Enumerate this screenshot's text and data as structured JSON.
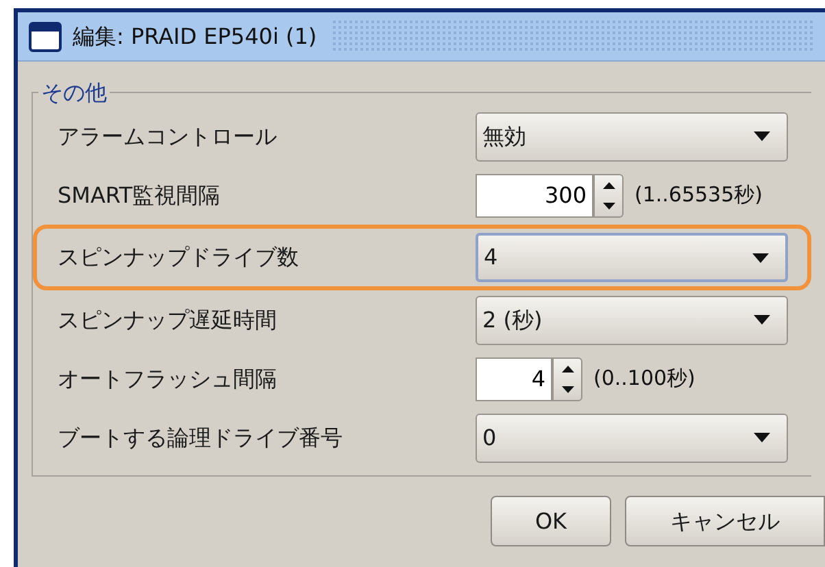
{
  "window": {
    "title": "編集: PRAID EP540i (1)"
  },
  "group": {
    "title": "その他",
    "rows": [
      {
        "label": "アラームコントロール",
        "kind": "select",
        "value": "無効",
        "highlighted": false
      },
      {
        "label": "SMART監視間隔",
        "kind": "spinner",
        "value": "300",
        "range": "(1..65535秒)",
        "highlighted": false
      },
      {
        "label": "スピンナップドライブ数",
        "kind": "select",
        "value": "4",
        "highlighted": true
      },
      {
        "label": "スピンナップ遅延時間",
        "kind": "select",
        "value": "2 (秒)",
        "highlighted": false
      },
      {
        "label": "オートフラッシュ間隔",
        "kind": "spinner",
        "value": "4",
        "range": "(0..100秒)",
        "highlighted": false
      },
      {
        "label": "ブートする論理ドライブ番号",
        "kind": "select",
        "value": "0",
        "highlighted": false
      }
    ]
  },
  "buttons": [
    "OK",
    "キャンセル"
  ]
}
